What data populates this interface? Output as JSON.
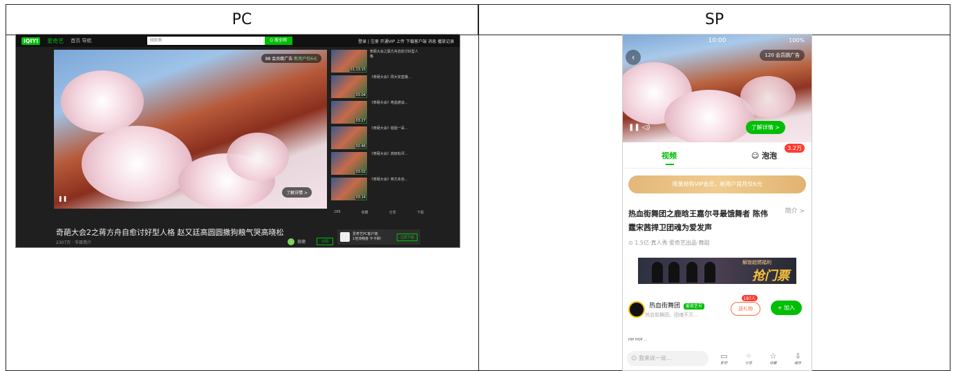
{
  "headers": {
    "pc": "PC",
    "sp": "SP"
  },
  "pc": {
    "brand": "爱奇艺",
    "nav": "首页 导航",
    "search_placeholder": "搜剧集",
    "search_btn": "Q 搜全网",
    "right_links": "登录 | 注册 开通VIP 上传 下载客户端 消息 播放记录",
    "ad_badge": "88 会员跳广告",
    "ad_link": "新用户仅6元",
    "detail_btn": "了解详情 >",
    "playlist": [
      {
        "dur": "01:13:15",
        "txt": "奇葩大会之蔡方舟自愈讨好型人格"
      },
      {
        "dur": "03:04",
        "txt": "《奇葩大会》周大安直播..."
      },
      {
        "dur": "03:27",
        "txt": "《奇葩大会》寿昌德谈..."
      },
      {
        "dur": "02:46",
        "txt": "《奇葩大会》姐姐一哥..."
      },
      {
        "dur": "03:02",
        "txt": "《奇葩大会》高晓松评..."
      },
      {
        "dur": "03:14",
        "txt": "《奇葩大会》蒋方舟自..."
      }
    ],
    "meta": [
      "288",
      "收藏",
      "分享",
      "下载"
    ],
    "title": "奇葩大会2之蒋方舟自愈讨好型人格 赵又廷高圆圆撒狗粮气哭高晓松",
    "sub": "2307万 · 节目简介",
    "follow_name": "奇葩",
    "follow_btn": "订阅",
    "client_title": "爱奇艺PC客户端",
    "client_desc": "1倍流畅度 不卡顿!",
    "client_btn": "立即下载"
  },
  "sp": {
    "time": "10:00",
    "battery": "100%",
    "ad_badge": "120 会员跳广告",
    "detail_btn": "了解详情 >",
    "tab_video": "视频",
    "tab_bubble": "泡泡",
    "bubble_badge": "3.2万",
    "vip_banner": "限量抢购VIP会员，新用户首月仅6元",
    "title": "热血街舞团之鹿晗王嘉尔寻最饿舞者 陈伟霆宋茜捍卫团魂为爱发声",
    "intro": "简介 >",
    "views": "1.5亿·真人秀·爱奇艺出品·舞蹈",
    "banner_small": "解锁超燃福利",
    "banner_big": "抢门票",
    "channel_name": "热血街舞团",
    "channel_tag": "爱奇艺号",
    "channel_desc": "热血街舞团，团魂不灭...",
    "gift_btn": "送礼物",
    "gift_badge": "187人",
    "join_btn": "+ 加入",
    "small_text": "HIP HOP ...",
    "comment_placeholder": "我来说一说...",
    "bottom_items": [
      "影吧",
      "分享",
      "收藏",
      "缓存"
    ]
  }
}
